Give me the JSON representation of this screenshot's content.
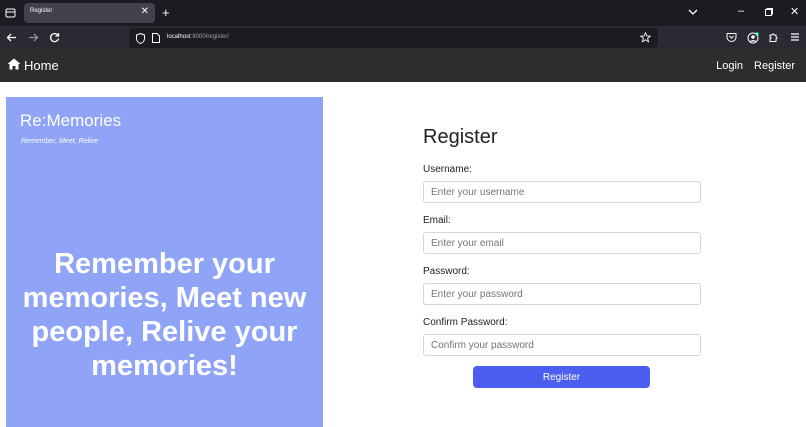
{
  "browser": {
    "tab_title": "Register",
    "url_host": "localhost",
    "url_path": ":8000/register/"
  },
  "header": {
    "home_label": "Home",
    "nav": [
      "Login",
      "Register"
    ]
  },
  "hero": {
    "brand": "Re:Memories",
    "tagline": "Remember, Meet, Relive",
    "headline": "Remember your memories, Meet new people, Relive your memories!",
    "background": "#8fa3f7"
  },
  "form": {
    "title": "Register",
    "fields": [
      {
        "label": "Username:",
        "placeholder": "Enter your username"
      },
      {
        "label": "Email:",
        "placeholder": "Enter your email"
      },
      {
        "label": "Password:",
        "placeholder": "Enter your password"
      },
      {
        "label": "Confirm Password:",
        "placeholder": "Confirm your password"
      }
    ],
    "submit_label": "Register",
    "accent": "#4c5ef0"
  }
}
